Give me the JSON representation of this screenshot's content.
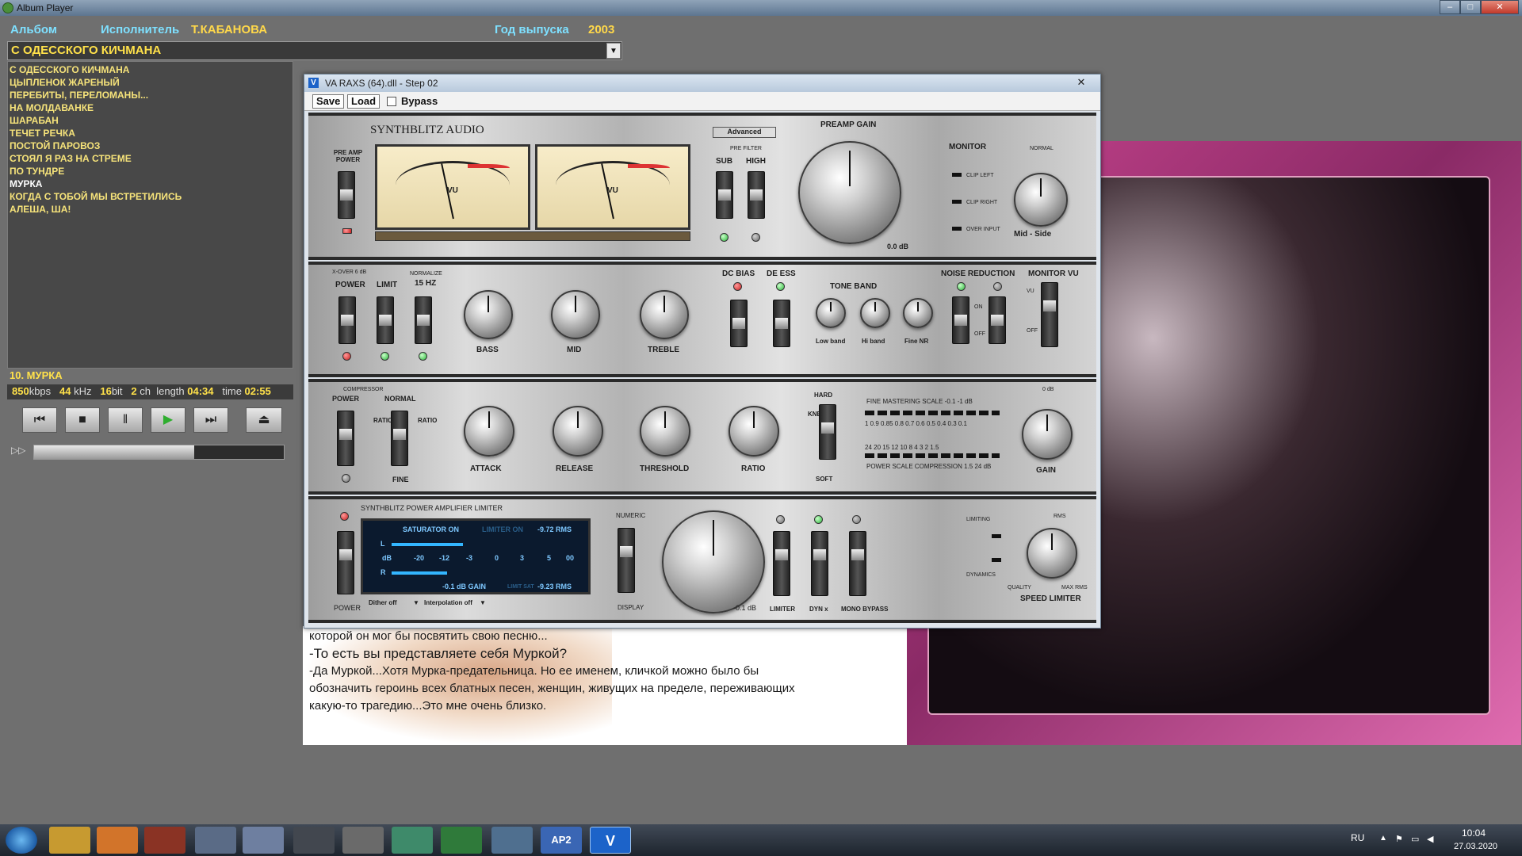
{
  "window": {
    "title": "Album Player",
    "controls": [
      "–",
      "□",
      "✕"
    ]
  },
  "header": {
    "album_label": "Альбом",
    "artist_label": "Исполнитель",
    "artist": "Т.КАБАНОВА",
    "year_label": "Год выпуска",
    "year": "2003"
  },
  "album_select": {
    "value": "С ОДЕССКОГО КИЧМАНА"
  },
  "tracks": [
    "С ОДЕССКОГО КИЧМАНА",
    "ЦЫПЛЕНОК ЖАРЕНЫЙ",
    "ПЕРЕБИТЫ, ПЕРЕЛОМАНЫ...",
    "НА МОЛДАВАНКЕ",
    "ШАРАБАН",
    "ТЕЧЕТ РЕЧКА",
    "ПОСТОЙ ПАРОВОЗ",
    "СТОЯЛ Я РАЗ НА СТРЕМЕ",
    "ПО ТУНДРЕ",
    "МУРКА",
    "КОГДА С ТОБОЙ МЫ ВСТРЕТИЛИСЬ",
    "АЛЕША, ША!"
  ],
  "now_playing": "10.  МУРКА",
  "info": {
    "kbps": "850",
    "kbps_unit": "kbps",
    "khz": "44",
    "khz_unit": "kHz",
    "bit": "16",
    "bit_unit": "bit",
    "ch": "2",
    "ch_unit": "ch",
    "length_label": "length",
    "length": "04:34",
    "time_label": "time",
    "time": "02:55"
  },
  "transport": {
    "prev": "⏮",
    "stop": "■",
    "pause": "‖",
    "play": "▶",
    "next": "⏭",
    "eject": "⏏",
    "ff": "▷▷"
  },
  "seek_progress": 0.64,
  "plugin": {
    "title": "VA RAXS (64).dll -    Step 02",
    "close": "✕",
    "save": "Save",
    "load": "Load",
    "bypass": "Bypass",
    "brand": "SYNTHBLITZ AUDIO",
    "p1": {
      "preamp_power": "PRE AMP POWER",
      "vu": "VU",
      "advanced": "Advanced",
      "pre_filter": "PRE FILTER",
      "sub": "SUB",
      "high": "HIGH",
      "preamp_gain": "PREAMP GAIN",
      "preamp_db": "0.0 dB",
      "monitor": "MONITOR",
      "clip_left": "CLIP LEFT",
      "clip_right": "CLIP RIGHT",
      "over_input": "OVER INPUT",
      "normal": "NORMAL",
      "mid_side": "Mid - Side"
    },
    "p2": {
      "xover": "X-OVER 6 dB",
      "power": "POWER",
      "limit": "LIMIT",
      "normalize": "NORMALIZE",
      "hz": "15 HZ",
      "bass": "BASS",
      "mid": "MID",
      "treble": "TREBLE",
      "dc_bias": "DC BIAS",
      "de_ess": "DE ESS",
      "tone_band": "TONE BAND",
      "low_band": "Low band",
      "hi_band": "Hi band",
      "fine_nr": "Fine NR",
      "noise_reduction": "NOISE REDUCTION",
      "monitor_vu": "MONITOR VU",
      "on": "ON",
      "off": "OFF",
      "vu": "VU"
    },
    "p3": {
      "compressor": "COMPRESSOR",
      "power": "POWER",
      "normal": "NORMAL",
      "fine": "FINE",
      "ratio_v": "RATIO",
      "attack": "ATTACK",
      "release": "RELEASE",
      "threshold": "THRESHOLD",
      "ratio": "RATIO",
      "hard": "HARD",
      "knee": "KNEE",
      "soft": "SOFT",
      "fine_scale": "FINE MASTERING SCALE -0.1  -1 dB",
      "scale_top": "1  0.9  0.85  0.8  0.7  0.6  0.5  0.4  0.3  0.1",
      "scale_bottom": "24  20  15  12  10  8  4  3  2  1.5",
      "power_scale": "POWER SCALE COMPRESSION 1.5     24 dB",
      "gain": "GAIN",
      "zero_db": "0 dB"
    },
    "p4": {
      "brand_line": "SYNTHBLITZ   POWER AMPLIFIER LIMITER",
      "saturator": "SATURATOR ON",
      "limiter_on": "LIMITER ON",
      "rms_top": "-9.72  RMS",
      "l": "L",
      "r": "R",
      "db": "dB",
      "scale": [
        "-20",
        "-12",
        "-3",
        "0",
        "3",
        "5",
        "00"
      ],
      "gain": "-0.1 dB GAIN",
      "limit_sat": "LIMIT SAT",
      "rms_bottom": "-9.23  RMS",
      "dither": "Dither off",
      "interp": "Interpolation off",
      "power": "POWER",
      "numeric": "NUMERIC",
      "display": "DISPLAY",
      "db01": "-0.1 dB",
      "limiter": "LIMITER",
      "dyn": "DYN x",
      "mono_bypass": "MONO BYPASS",
      "limiting": "LIMITING",
      "dynamics": "DYNAMICS",
      "quality": "QUALITY",
      "rms": "RMS",
      "max_rms": "MAX RMS",
      "speed_limiter": "SPEED LIMITER"
    }
  },
  "text_lines": [
    "которой он мог бы посвятить свою песню...",
    "-То есть вы представляете себя Муркой?",
    "-Да Муркой...Хотя Мурка-предательница. Но ее именем, кличкой можно было бы",
    "обозначить героинь всех блатных песен, женщин, живущих на пределе, переживающих",
    "какую-то трагедию...Это мне очень близко."
  ],
  "taskbar": {
    "lang": "RU",
    "time": "10:04",
    "date": "27.03.2020",
    "apps": [
      "folder-icon",
      "media-icon",
      "firefox-icon",
      "computer-icon",
      "document-icon",
      "fox-icon",
      "paint-icon",
      "globe-icon",
      "spiral-icon",
      "monitor-icon",
      "ap2-icon",
      "v-icon"
    ],
    "ap2": "AP2",
    "v": "V"
  }
}
